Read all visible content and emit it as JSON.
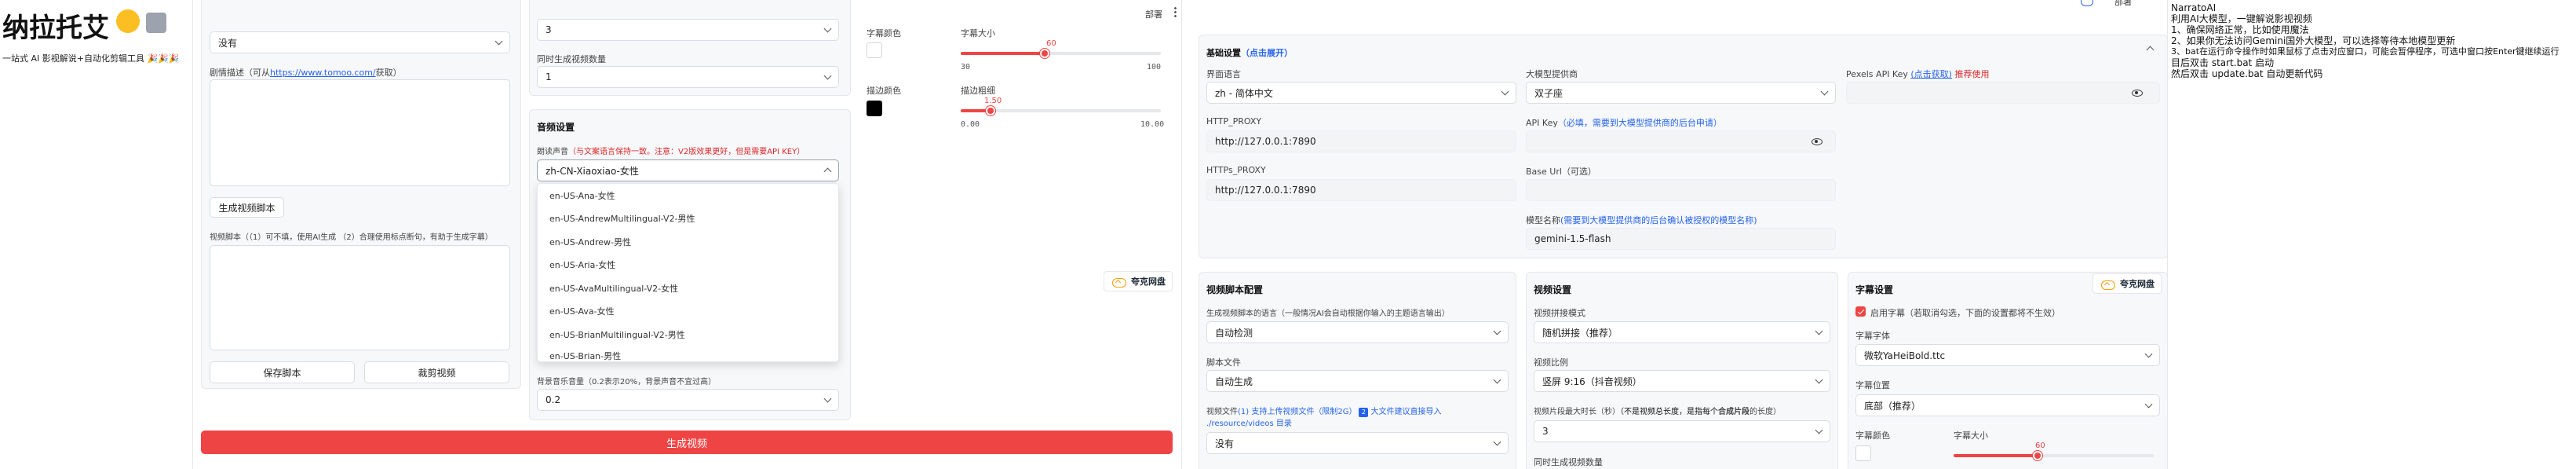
{
  "left": {
    "title": "纳拉托艾",
    "tagline": "一站式 AI 影视解说+自动化剪辑工具 🎉🎉🎉"
  },
  "screen1": {
    "script_language_value": "没有",
    "drama_label_prefix": "剧情描述（可从",
    "drama_link": "https://www.tomoo.com/",
    "drama_label_suffix": "获取）",
    "gen_script_button": "生成视频脚本",
    "video_script_label": "视频脚本（（1）可不填，使用AI生成 （2）合理使用标点断句，有助于生成字幕）",
    "save_button": "保存脚本",
    "crop_button": "裁剪视频",
    "generate_button": "生成视频",
    "top_value_1": "3",
    "concurrent_label": "同时生成视频数量",
    "concurrent_value": "1",
    "audio_section": "音频设置",
    "voice_label": "朗读声音",
    "voice_note": "（与文案语言保持一致。注意：V2版效果更好，但是需要API KEY）",
    "voice_value": "zh-CN-Xiaoxiao-女性",
    "voice_options": [
      "en-US-Ana-女性",
      "en-US-AndrewMultilingual-V2-男性",
      "en-US-Andrew-男性",
      "en-US-Aria-女性",
      "en-US-AvaMultilingual-V2-女性",
      "en-US-Ava-女性",
      "en-US-BrianMultilingual-V2-男性",
      "en-US-Brian-男性"
    ],
    "bgm_volume_label": "背景音乐音量（0.2表示20%，背景声音不宜过高）",
    "bgm_volume_value": "0.2",
    "font_color_label": "字幕颜色",
    "font_size_label": "字幕大小",
    "font_size": {
      "value": 60,
      "min": 30,
      "max": 100
    },
    "stroke_color_label": "描边颜色",
    "stroke_width_label": "描边粗细",
    "stroke_width": {
      "value": 1.5,
      "min": "0.00",
      "max": "10.00",
      "shown": "1.50"
    },
    "deploy_label": "部署",
    "badge": "夸克网盘"
  },
  "screen2": {
    "basic_settings": "基础设置",
    "basic_settings_note": "（点击展开）",
    "ui_language_label": "界面语言",
    "ui_language_value": "zh - 简体中文",
    "http_proxy_label": "HTTP_PROXY",
    "http_proxy_value": "http://127.0.0.1:7890",
    "https_proxy_label": "HTTPs_PROXY",
    "https_proxy_value": "http://127.0.0.1:7890",
    "llm_provider_label": "大模型提供商",
    "llm_provider_value": "双子座",
    "api_key_label": "API Key",
    "api_key_note": "（必填，需要到大模型提供商的后台申请）",
    "base_url_label": "Base Url（可选）",
    "model_name_label": "模型名称",
    "model_name_note": "(需要到大模型提供商的后台确认被授权的模型名称)",
    "model_name_value": "gemini-1.5-flash",
    "pexels_label": "Pexels API Key",
    "pexels_link": "(点击获取)",
    "pexels_note": "推荐使用",
    "deploy_label": "部署",
    "video_script_config": "视频脚本配置",
    "script_lang_label": "生成视频脚本的语言（一般情况AI会自动根据你输入的主题语言输出）",
    "script_lang_value": "自动检测",
    "script_file_label": "脚本文件",
    "script_file_value": "自动生成",
    "video_file_label": "视频文件",
    "video_file_note_1": "(1) 支持上传视频文件（限制2G）",
    "video_file_note_2": "大文件建议直接导入",
    "video_file_note_3": "./resource/videos 目录",
    "video_file_info_icon": "2",
    "video_file_value": "没有",
    "video_settings": "视频设置",
    "concat_mode_label": "视频拼接模式",
    "concat_mode_value": "随机拼接（推荐）",
    "aspect_label": "视频比例",
    "aspect_value": "竖屏 9:16（抖音视频）",
    "clip_duration_label": "视频片段最大时长（秒）",
    "clip_duration_note": "（不是视频总长度，是指每个",
    "clip_duration_note_bold": "合成片段",
    "clip_duration_note_end": "的长度）",
    "clip_duration_value": "3",
    "concurrent_label": "同时生成视频数量",
    "subtitle_settings": "字幕设置",
    "enable_subtitle_label": "启用字幕（若取消勾选，下面的设置都将不生效）",
    "font_label": "字幕字体",
    "font_value": "微软YaHeiBold.ttc",
    "position_label": "字幕位置",
    "position_value": "底部（推荐）",
    "font_color_label": "字幕颜色",
    "font_size_label": "字幕大小",
    "font_size": {
      "value": 60
    },
    "badge": "夸克网盘"
  },
  "right": {
    "title": "NarratoAI",
    "lines": [
      "利用AI大模型，一键解说影视视频",
      "1、确保网络正常，比如使用魔法",
      "2、如果你无法访问Gemini国外大模型，可以选择等待本地模型更新",
      "3、bat在运行命令操作时如果鼠标了点击对应窗口，可能会暂停程序，可选中窗口按Enter键继续运行",
      "目后双击 start.bat 启动",
      "然后双击 update.bat 自动更新代码"
    ]
  },
  "colors": {
    "accent": "#ef4444",
    "link": "#2563eb",
    "font_color_swatch": "#ffffff",
    "stroke_color_swatch": "#000000"
  }
}
